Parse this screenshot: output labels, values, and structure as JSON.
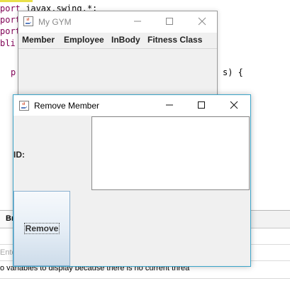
{
  "ide": {
    "code_lines": [
      {
        "kw": "port ",
        "rest": "javax.swing.*;"
      },
      {
        "kw": "port",
        "rest": ""
      },
      {
        "kw": "port",
        "rest": ""
      },
      {
        "kw": "bli",
        "rest": ""
      }
    ],
    "code_indent_line": "p",
    "code_trail": "s) {",
    "console_tab": "Br",
    "console_input_placeholder": "Ente",
    "console_message": "o variables to display because there is no current threa"
  },
  "gym_window": {
    "title": "My GYM",
    "menu": [
      "Member",
      "Employee",
      "InBody",
      "Fitness Class"
    ]
  },
  "remove_window": {
    "title": "Remove Member",
    "id_label": "ID:",
    "text_area_value": "",
    "remove_button_label": "Remove"
  },
  "colors": {
    "active_border": "#3aa3c8",
    "inactive_title": "#8a8a8a",
    "button_gradient_bottom": "#cddcea"
  },
  "icons": {
    "java_window_icon": "java-cup-icon",
    "minimize": "minimize-icon",
    "maximize": "maximize-icon",
    "close": "close-icon"
  }
}
